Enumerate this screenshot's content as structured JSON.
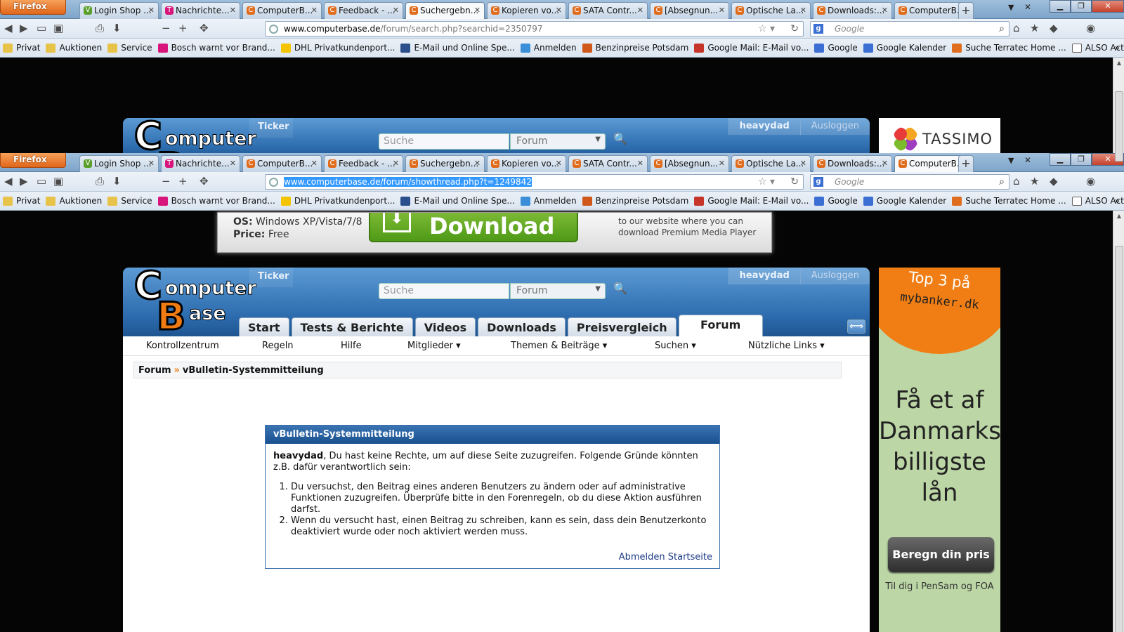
{
  "window1": {
    "firefox_label": "Firefox",
    "tabs": [
      {
        "label": "Login Shop ...",
        "fav": "V",
        "color": "#5a9f2a"
      },
      {
        "label": "Nachrichte...",
        "fav": "T",
        "color": "#d8157a"
      },
      {
        "label": "ComputerB...",
        "fav": "C",
        "color": "#e06d1d"
      },
      {
        "label": "Feedback - ...",
        "fav": "C",
        "color": "#e06d1d"
      },
      {
        "label": "Suchergebn...",
        "fav": "C",
        "color": "#e06d1d"
      },
      {
        "label": "Kopieren vo...",
        "fav": "C",
        "color": "#e06d1d"
      },
      {
        "label": "SATA Contr...",
        "fav": "C",
        "color": "#e06d1d"
      },
      {
        "label": "[Absegnun...",
        "fav": "C",
        "color": "#e06d1d"
      },
      {
        "label": "Optische La...",
        "fav": "C",
        "color": "#e06d1d"
      },
      {
        "label": "Downloads:...",
        "fav": "C",
        "color": "#e06d1d"
      },
      {
        "label": "ComputerB...",
        "fav": "C",
        "color": "#e06d1d"
      }
    ],
    "selected_tab": 4,
    "url_host": "www.computerbase.de",
    "url_path": "/forum/search.php?searchid=2350797",
    "search_placeholder": "Google"
  },
  "window2": {
    "firefox_label": "Firefox",
    "tabs": [
      {
        "label": "Login Shop ...",
        "fav": "V",
        "color": "#5a9f2a"
      },
      {
        "label": "Nachrichte...",
        "fav": "T",
        "color": "#d8157a"
      },
      {
        "label": "ComputerB...",
        "fav": "C",
        "color": "#e06d1d"
      },
      {
        "label": "Feedback - ...",
        "fav": "C",
        "color": "#e06d1d"
      },
      {
        "label": "Suchergebn...",
        "fav": "C",
        "color": "#e06d1d"
      },
      {
        "label": "Kopieren vo...",
        "fav": "C",
        "color": "#e06d1d"
      },
      {
        "label": "SATA Contr...",
        "fav": "C",
        "color": "#e06d1d"
      },
      {
        "label": "[Absegnun...",
        "fav": "C",
        "color": "#e06d1d"
      },
      {
        "label": "Optische La...",
        "fav": "C",
        "color": "#e06d1d"
      },
      {
        "label": "Downloads:...",
        "fav": "C",
        "color": "#e06d1d"
      },
      {
        "label": "ComputerB...",
        "fav": "C",
        "color": "#e06d1d"
      }
    ],
    "selected_tab": 10,
    "url_selected": "www.computerbase.de/forum/showthread.php?t=1249842",
    "search_placeholder": "Google"
  },
  "bookmarks": [
    {
      "label": "Privat",
      "icon": "folder-icon",
      "color": "#e8c34a"
    },
    {
      "label": "Auktionen",
      "icon": "folder-icon",
      "color": "#e8c34a"
    },
    {
      "label": "Service",
      "icon": "folder-icon",
      "color": "#e8c34a"
    },
    {
      "label": "Bosch warnt vor Brand...",
      "icon": "telekom-icon",
      "color": "#d8157a"
    },
    {
      "label": "DHL Privatkundenport...",
      "icon": "dhl-icon",
      "color": "#f5c400"
    },
    {
      "label": "E-Mail und Online Spe...",
      "icon": "web-icon",
      "color": "#2b4f8c"
    },
    {
      "label": "Anmelden",
      "icon": "windows-icon",
      "color": "#3a8fd8"
    },
    {
      "label": "Benzinpreise Potsdam",
      "icon": "fuel-icon",
      "color": "#d0581a"
    },
    {
      "label": "Google Mail: E-Mail vo...",
      "icon": "gmail-icon",
      "color": "#c6342a"
    },
    {
      "label": "Google",
      "icon": "google-icon",
      "color": "#3b6fd4"
    },
    {
      "label": "Google Kalender",
      "icon": "calendar-icon",
      "color": "#3b6fd4"
    },
    {
      "label": "Suche Terratec Home ...",
      "icon": "computerbase-icon",
      "color": "#e06d1d"
    },
    {
      "label": "ALSO Actebis B-Waren...",
      "icon": "page-icon",
      "color": "#ffffff"
    }
  ],
  "site": {
    "ticker": "Ticker",
    "search_placeholder": "Suche",
    "search_scope": "Forum",
    "username": "heavydad",
    "logout": "Ausloggen",
    "logo_c": "C",
    "logo_omputer": "omputer",
    "logo_b": "B",
    "logo_ase": "ase",
    "nav_tabs": [
      "Start",
      "Tests & Berichte",
      "Videos",
      "Downloads",
      "Preisvergleich",
      "Forum"
    ],
    "active_tab": "Forum",
    "subnav": [
      "Kontrollzentrum",
      "Regeln",
      "Hilfe",
      "Mitglieder ▾",
      "Themen & Beiträge ▾",
      "Suchen ▾",
      "Nützliche Links ▾"
    ],
    "breadcrumb_root": "Forum",
    "breadcrumb_sep": "»",
    "breadcrumb_current": "vBulletin-Systemmitteilung"
  },
  "message": {
    "title": "vBulletin-Systemmitteilung",
    "user": "heavydad",
    "intro": ", Du hast keine Rechte, um auf diese Seite zuzugreifen. Folgende Gründe könnten z.B. dafür verantwortlich sein:",
    "reasons": [
      "Du versuchst, den Beitrag eines anderen Benutzers zu ändern oder auf administrative Funktionen zuzugreifen. Überprüfe bitte in den Forenregeln, ob du diese Aktion ausführen darfst.",
      "Wenn du versucht hast, einen Beitrag zu schreiben, kann es sein, dass dein Benutzerkonto deaktiviert wurde oder noch aktiviert werden muss."
    ],
    "link_logout": "Abmelden",
    "link_home": "Startseite"
  },
  "ads": {
    "tassimo": "TASSIMO",
    "banner_os_label": "OS:",
    "banner_os": "Windows XP/Vista/7/8",
    "banner_price_label": "Price:",
    "banner_price": "Free",
    "banner_download": "Download",
    "banner_text": "to our website where you can download Premium Media Player",
    "mybanker_top": "Top 3 på",
    "mybanker_domain": "mybanker.dk",
    "mybanker_headline": "Få et af Danmarks billigste lån",
    "mybanker_button": "Beregn din pris",
    "mybanker_footer": "Til dig i  PenSam og FOA"
  }
}
